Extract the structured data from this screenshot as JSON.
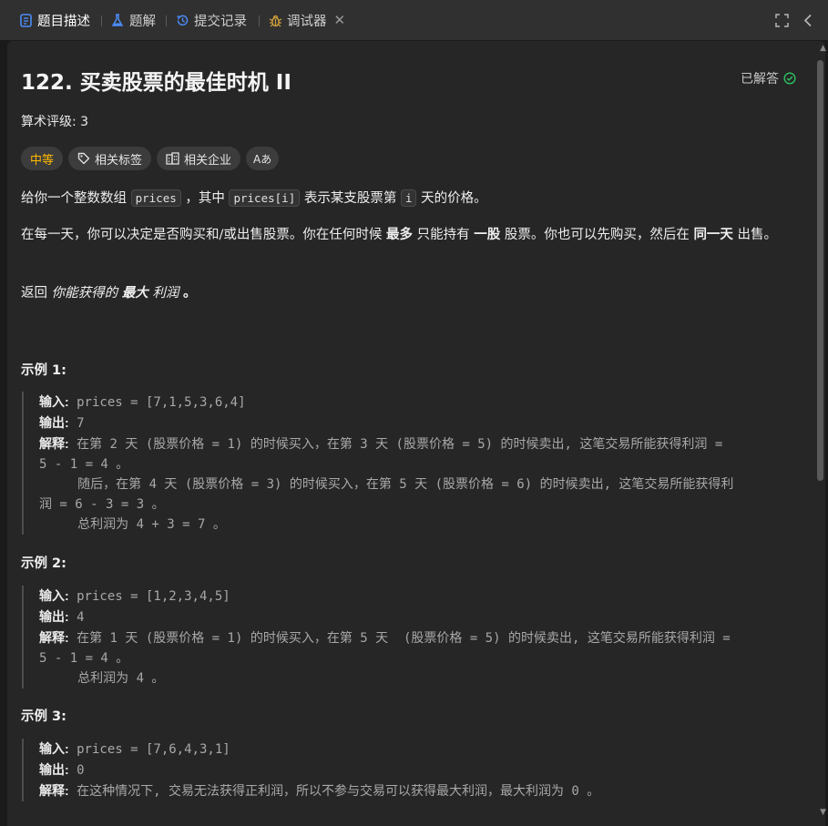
{
  "tabs": {
    "description": "题目描述",
    "solutions": "题解",
    "submissions": "提交记录",
    "debugger": "调试器"
  },
  "problem": {
    "title": "122. 买卖股票的最佳时机 II",
    "status": "已解答",
    "rating": "算术评级: 3",
    "tags": {
      "difficulty": "中等",
      "related_tags": "相关标签",
      "related_companies": "相关企业",
      "translate": "Aあ"
    },
    "desc1": {
      "a": "给你一个整数数组",
      "code1": "prices",
      "b": "，其中",
      "code2": "prices[i]",
      "c": "表示某支股票第",
      "code3": "i",
      "d": "天的价格。"
    },
    "desc2": {
      "a": "在每一天，你可以决定是否购买和/或出售股票。你在任何时候",
      "b1": "最多",
      "b": "只能持有",
      "b2": "一股",
      "c": "股票。你也可以先购买，然后在",
      "b3": "同一天",
      "d": "出售。"
    },
    "desc3": {
      "a": "返回",
      "i1": "你能获得的",
      "b1": "最大",
      "i2": "利润",
      "c": "。"
    }
  },
  "examples": [
    {
      "heading": "示例 1:",
      "input_label": "输入:",
      "input": "prices = [7,1,5,3,6,4]",
      "output_label": "输出:",
      "output": "7",
      "explain_label": "解释:",
      "explain": [
        "在第 2 天 (股票价格 = 1) 的时候买入，在第 3 天 (股票价格 = 5) 的时候卖出, 这笔交易所能获得利润 =",
        "5 - 1 = 4 。",
        "     随后，在第 4 天 (股票价格 = 3) 的时候买入，在第 5 天 (股票价格 = 6) 的时候卖出, 这笔交易所能获得利",
        "润 = 6 - 3 = 3 。",
        "     总利润为 4 + 3 = 7 。"
      ]
    },
    {
      "heading": "示例 2:",
      "input_label": "输入:",
      "input": "prices = [1,2,3,4,5]",
      "output_label": "输出:",
      "output": "4",
      "explain_label": "解释:",
      "explain": [
        "在第 1 天 (股票价格 = 1) 的时候买入，在第 5 天  (股票价格 = 5) 的时候卖出, 这笔交易所能获得利润 =",
        "5 - 1 = 4 。",
        "     总利润为 4 。"
      ]
    },
    {
      "heading": "示例 3:",
      "input_label": "输入:",
      "input": "prices = [7,6,4,3,1]",
      "output_label": "输出:",
      "output": "0",
      "explain_label": "解释:",
      "explain": [
        "在这种情况下, 交易无法获得正利润，所以不参与交易可以获得最大利润，最大利润为 0 。"
      ]
    }
  ],
  "colors": {
    "accent_blue": "#4c8bf5",
    "difficulty_medium": "#ffb800",
    "solved_green": "#2cbb5d",
    "debugger_icon": "#c79a3b"
  }
}
